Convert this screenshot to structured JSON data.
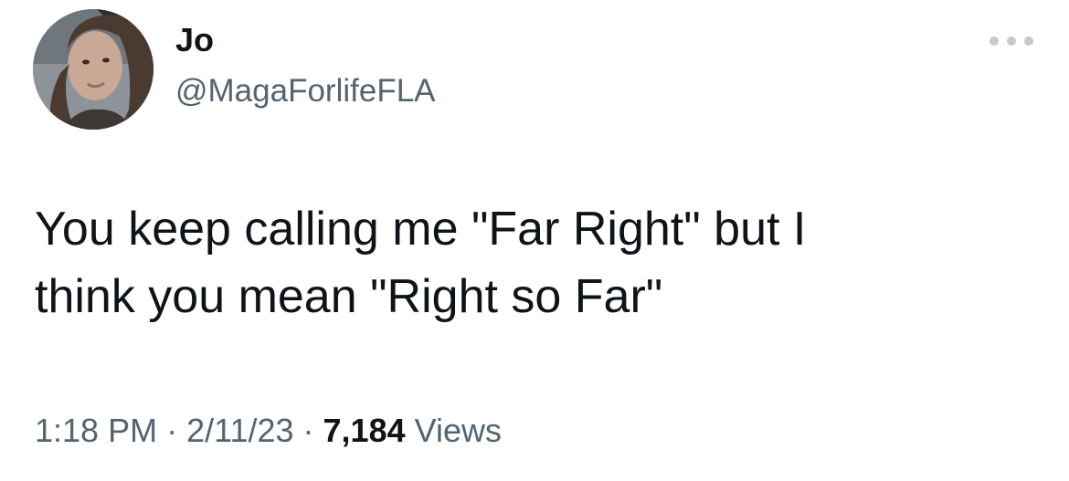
{
  "author": {
    "display_name": "Jo",
    "handle": "@MagaForlifeFLA",
    "avatar_icon": "profile-photo"
  },
  "more_icon": "more-horizontal-icon",
  "tweet": {
    "text": "You keep calling me \"Far Right\" but I\nthink you mean \"Right so Far\""
  },
  "meta": {
    "time": "1:18 PM",
    "date": "2/11/23",
    "separator": "·",
    "views_count": "7,184",
    "views_label": "Views"
  },
  "colors": {
    "text_primary": "#0f1419",
    "text_secondary": "#536471",
    "dots": "#c4cad0"
  }
}
